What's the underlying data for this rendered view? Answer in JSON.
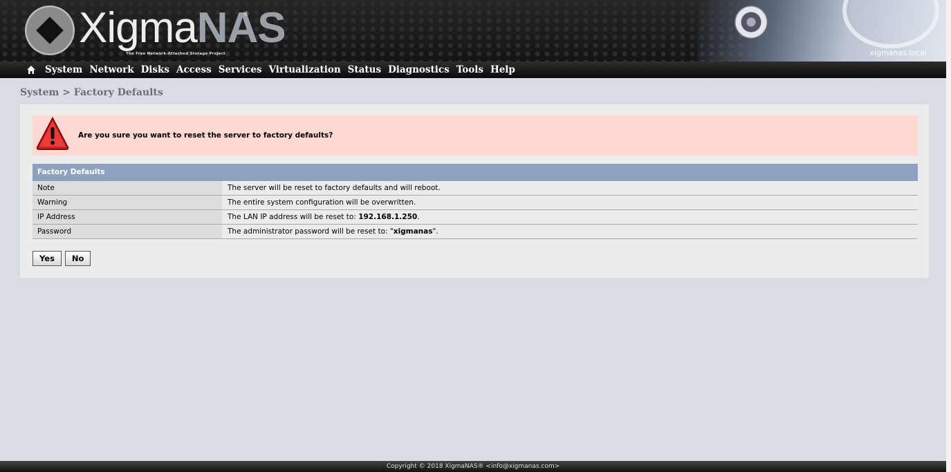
{
  "header": {
    "logo_text_a": "Xigma",
    "logo_text_b": "NAS",
    "logo_reg": "®",
    "tagline": "The Free Network-Attached Storage Project",
    "hostname": "xigmanas.local"
  },
  "nav": {
    "home_icon": "home-icon",
    "items": [
      "System",
      "Network",
      "Disks",
      "Access",
      "Services",
      "Virtualization",
      "Status",
      "Diagnostics",
      "Tools",
      "Help"
    ]
  },
  "breadcrumb": "System > Factory Defaults",
  "alert": {
    "icon": "warning-icon",
    "color": "#ffd8d3",
    "message": "Are you sure you want to reset the server to factory defaults?"
  },
  "table": {
    "title": "Factory Defaults",
    "rows": [
      {
        "label": "Note",
        "value": "The server will be reset to factory defaults and will reboot.",
        "bold": ""
      },
      {
        "label": "Warning",
        "value": "The entire system configuration will be overwritten.",
        "bold": ""
      },
      {
        "label": "IP Address",
        "value_pre": "The LAN IP address will be reset to: ",
        "bold": "192.168.1.250",
        "value_post": "."
      },
      {
        "label": "Password",
        "value_pre": "The administrator password will be reset to: \"",
        "bold": "xigmanas",
        "value_post": "\"."
      }
    ]
  },
  "buttons": {
    "yes": "Yes",
    "no": "No"
  },
  "footer": "Copyright © 2018 XigmaNAS® <info@xigmanas.com>"
}
